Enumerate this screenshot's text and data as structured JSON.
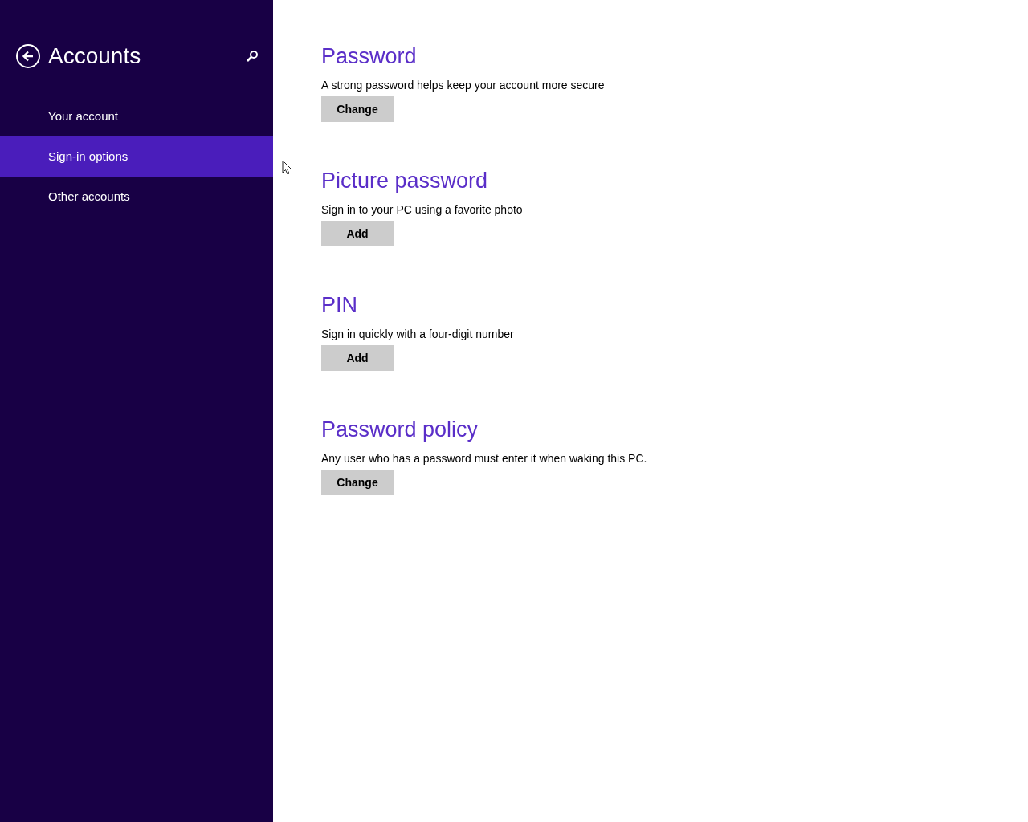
{
  "sidebar": {
    "title": "Accounts",
    "items": [
      {
        "label": "Your account",
        "selected": false
      },
      {
        "label": "Sign-in options",
        "selected": true
      },
      {
        "label": "Other accounts",
        "selected": false
      }
    ]
  },
  "sections": [
    {
      "heading": "Password",
      "description": "A strong password helps keep your account more secure",
      "button": "Change"
    },
    {
      "heading": "Picture password",
      "description": "Sign in to your PC using a favorite photo",
      "button": "Add"
    },
    {
      "heading": "PIN",
      "description": "Sign in quickly with a four-digit number",
      "button": "Add"
    },
    {
      "heading": "Password policy",
      "description": "Any user who has a password must enter it when waking this PC.",
      "button": "Change"
    }
  ]
}
